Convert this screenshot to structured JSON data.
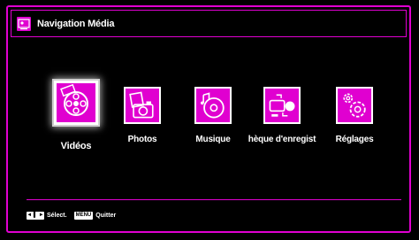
{
  "header": {
    "title": "Navigation Média",
    "icon": "media-browser-icon"
  },
  "menu": {
    "items": [
      {
        "label": "Vidéos",
        "icon": "film-reel-icon",
        "selected": true
      },
      {
        "label": "Photos",
        "icon": "photos-camera-icon",
        "selected": false
      },
      {
        "label": "Musique",
        "icon": "music-disc-icon",
        "selected": false
      },
      {
        "label": "hèque d'enregist",
        "icon": "recordings-library-icon",
        "selected": false
      },
      {
        "label": "Réglages",
        "icon": "settings-gears-icon",
        "selected": false
      }
    ]
  },
  "footer": {
    "select_key": "◄ ▌ ►",
    "select_label": "Sélect.",
    "menu_key": "MENU",
    "quit_label": "Quitter"
  },
  "colors": {
    "accent": "#e000d0",
    "background": "#000000",
    "text": "#ffffff"
  }
}
